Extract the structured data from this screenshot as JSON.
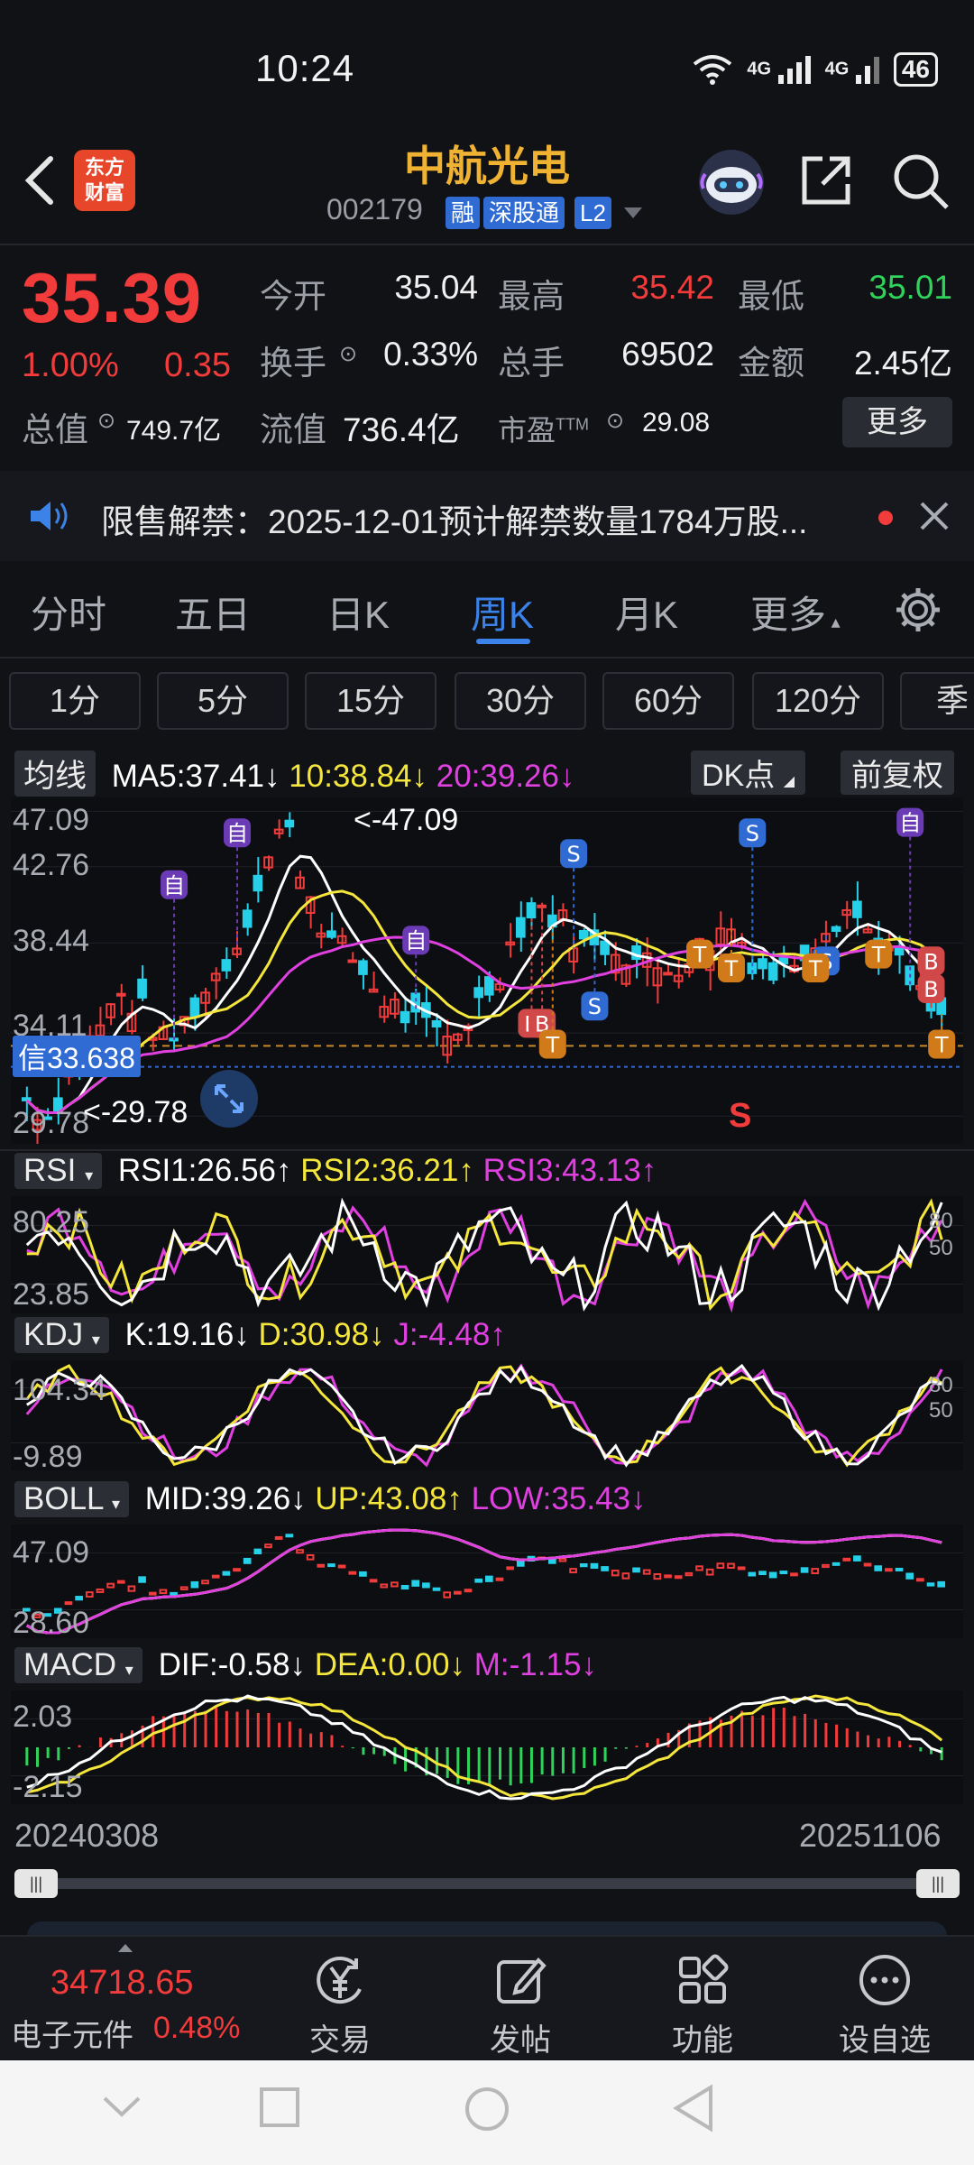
{
  "status": {
    "time": "10:24",
    "battery": "46",
    "net1": "4G",
    "net2": "4G"
  },
  "header": {
    "title": "中航光电",
    "code": "002179",
    "tags": [
      "融",
      "深股通",
      "L2"
    ],
    "logo_line1": "东方",
    "logo_line2": "财富"
  },
  "quote": {
    "price": "35.39",
    "change_pct": "1.00%",
    "change": "0.35",
    "open_label": "今开",
    "open": "35.04",
    "high_label": "最高",
    "high": "35.42",
    "low_label": "最低",
    "low": "35.01",
    "turnover_label": "换手",
    "turnover": "0.33%",
    "volume_label": "总手",
    "volume": "69502",
    "amount_label": "金额",
    "amount": "2.45亿",
    "mcap_label": "总值",
    "mcap": "749.7亿",
    "float_label": "流值",
    "float": "736.4亿",
    "pe_label": "市盈",
    "pe_sup": "TTM",
    "pe": "29.08",
    "more": "更多"
  },
  "notice": {
    "text": "限售解禁：2025-12-01预计解禁数量1784万股..."
  },
  "period_tabs": [
    "分时",
    "五日",
    "日K",
    "周K",
    "月K",
    "更多"
  ],
  "active_tab": "周K",
  "minute_buttons": [
    "1分",
    "5分",
    "15分",
    "30分",
    "60分",
    "120分",
    "季"
  ],
  "main_chart": {
    "selector": "均线",
    "ma5": "MA5:37.41↓",
    "ma10": "10:38.84↓",
    "ma20": "20:39.26↓",
    "dk": "DK点",
    "adjust": "前复权",
    "y_labels": [
      "47.09",
      "42.76",
      "38.44",
      "34.11",
      "29.78"
    ],
    "max_label": "<-47.09",
    "min_label": "<-29.78",
    "signal_label": "信33.638",
    "signal_markers": [
      "自",
      "自",
      "自",
      "自",
      "S",
      "S",
      "S",
      "S",
      "B",
      "B",
      "B",
      "B",
      "T",
      "T",
      "T",
      "T",
      "T",
      "T"
    ],
    "s_red": "S"
  },
  "rsi": {
    "selector": "RSI",
    "rsi1": "RSI1:26.56↑",
    "rsi2": "RSI2:36.21↑",
    "rsi3": "RSI3:43.13↑",
    "y_top": "80.25",
    "y_bottom": "23.85",
    "r_top": "80",
    "r_bottom": "50"
  },
  "kdj": {
    "selector": "KDJ",
    "k": "K:19.16↓",
    "d": "D:30.98↓",
    "j": "J:-4.48↑",
    "y_top": "104.34",
    "y_bottom": "-9.89",
    "r_top": "80",
    "r_bottom": "50"
  },
  "boll": {
    "selector": "BOLL",
    "mid": "MID:39.26↓",
    "up": "UP:43.08↑",
    "low": "LOW:35.43↓",
    "y_top": "47.09",
    "y_bottom": "28.60"
  },
  "macd": {
    "selector": "MACD",
    "dif": "DIF:-0.58↓",
    "dea": "DEA:0.00↓",
    "m": "M:-1.15↓",
    "y_top": "2.03",
    "y_bottom": "-2.15"
  },
  "dates": {
    "start": "20240308",
    "end": "20251106"
  },
  "bottom_bar": {
    "index_value": "34718.65",
    "index_name": "电子元件",
    "index_pct": "0.48%",
    "trade": "交易",
    "post": "发帖",
    "func": "功能",
    "watch": "设自选"
  },
  "colors": {
    "up": "#f23b3b",
    "down": "#25d0e8",
    "ma5": "#ffffff",
    "ma10": "#f5e63c",
    "ma20": "#e040e0",
    "accent": "#3b83e8",
    "brand": "#f0b232"
  }
}
